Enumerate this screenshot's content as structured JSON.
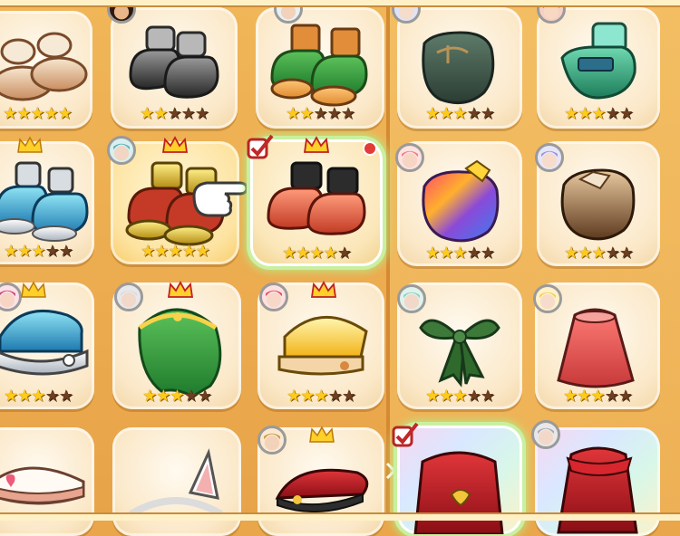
{
  "screen": "equipment-inventory-grid",
  "colors": {
    "star_on": "#ffcb1a",
    "star_off": "#6b3f20",
    "selected_glow": "#b9ea86",
    "new_badge": "#e23b38",
    "crown": "#ffcf2a"
  },
  "items": [
    {
      "id": "r1c1",
      "kind": "boots",
      "name_hint": "beige-furry-boots",
      "stars": 5,
      "filled": 5,
      "crown": false,
      "avatar": false
    },
    {
      "id": "r1c2",
      "kind": "boots",
      "name_hint": "black-boots",
      "stars": 5,
      "filled": 2,
      "crown": false,
      "avatar": true
    },
    {
      "id": "r1c3",
      "kind": "boots",
      "name_hint": "green-orange-boots",
      "stars": 5,
      "filled": 2,
      "crown": false,
      "avatar": true
    },
    {
      "id": "r1c4",
      "kind": "gloves",
      "name_hint": "dark-green-glove",
      "stars": 5,
      "filled": 3,
      "crown": false,
      "avatar": true
    },
    {
      "id": "r1c5",
      "kind": "gloves",
      "name_hint": "teal-glove",
      "stars": 5,
      "filled": 3,
      "crown": false,
      "avatar": true
    },
    {
      "id": "r2c1",
      "kind": "boots",
      "name_hint": "blue-scale-boots",
      "stars": 5,
      "filled": 3,
      "crown": true,
      "avatar": false
    },
    {
      "id": "r2c2",
      "kind": "boots",
      "name_hint": "gold-red-boots",
      "stars": 5,
      "filled": 5,
      "crown": true,
      "avatar": true,
      "golden": true
    },
    {
      "id": "r2c3",
      "kind": "boots",
      "name_hint": "red-black-boots",
      "stars": 5,
      "filled": 4,
      "crown": true,
      "avatar": false,
      "selected": true,
      "checked": true,
      "new_badge": true
    },
    {
      "id": "r2c4",
      "kind": "gloves",
      "name_hint": "rainbow-glove",
      "stars": 5,
      "filled": 3,
      "crown": false,
      "avatar": true
    },
    {
      "id": "r2c5",
      "kind": "gloves",
      "name_hint": "brown-glove",
      "stars": 5,
      "filled": 3,
      "crown": false,
      "avatar": true
    },
    {
      "id": "r3c1",
      "kind": "hat",
      "name_hint": "blue-scale-helmet",
      "stars": 5,
      "filled": 3,
      "crown": true,
      "avatar": true
    },
    {
      "id": "r3c2",
      "kind": "hat",
      "name_hint": "green-veil-headdress",
      "stars": 5,
      "filled": 3,
      "crown": true,
      "avatar": true
    },
    {
      "id": "r3c3",
      "kind": "hat",
      "name_hint": "yellow-cap",
      "stars": 5,
      "filled": 3,
      "crown": true,
      "avatar": true
    },
    {
      "id": "r3c4",
      "kind": "accessory",
      "name_hint": "green-ribbon",
      "stars": 5,
      "filled": 3,
      "crown": false,
      "avatar": true
    },
    {
      "id": "r3c5",
      "kind": "cape",
      "name_hint": "red-cape",
      "stars": 5,
      "filled": 3,
      "crown": false,
      "avatar": true
    },
    {
      "id": "r4c1",
      "kind": "hat",
      "name_hint": "white-heart-hat",
      "stars": 0,
      "filled": 0,
      "crown": false,
      "avatar": false
    },
    {
      "id": "r4c2",
      "kind": "hat",
      "name_hint": "cat-ear-headband",
      "stars": 0,
      "filled": 0,
      "crown": false,
      "avatar": false
    },
    {
      "id": "r4c3",
      "kind": "hat",
      "name_hint": "dark-red-beret",
      "stars": 0,
      "filled": 0,
      "crown": true,
      "avatar": true
    },
    {
      "id": "r4c4",
      "kind": "cape",
      "name_hint": "royal-red-cape",
      "stars": 0,
      "filled": 0,
      "crown": false,
      "avatar": false,
      "checked": true,
      "selected": true,
      "rainbow": true
    },
    {
      "id": "r4c5",
      "kind": "cape",
      "name_hint": "crimson-scarf-cape",
      "stars": 0,
      "filled": 0,
      "crown": false,
      "avatar": true,
      "rainbow": true
    }
  ]
}
